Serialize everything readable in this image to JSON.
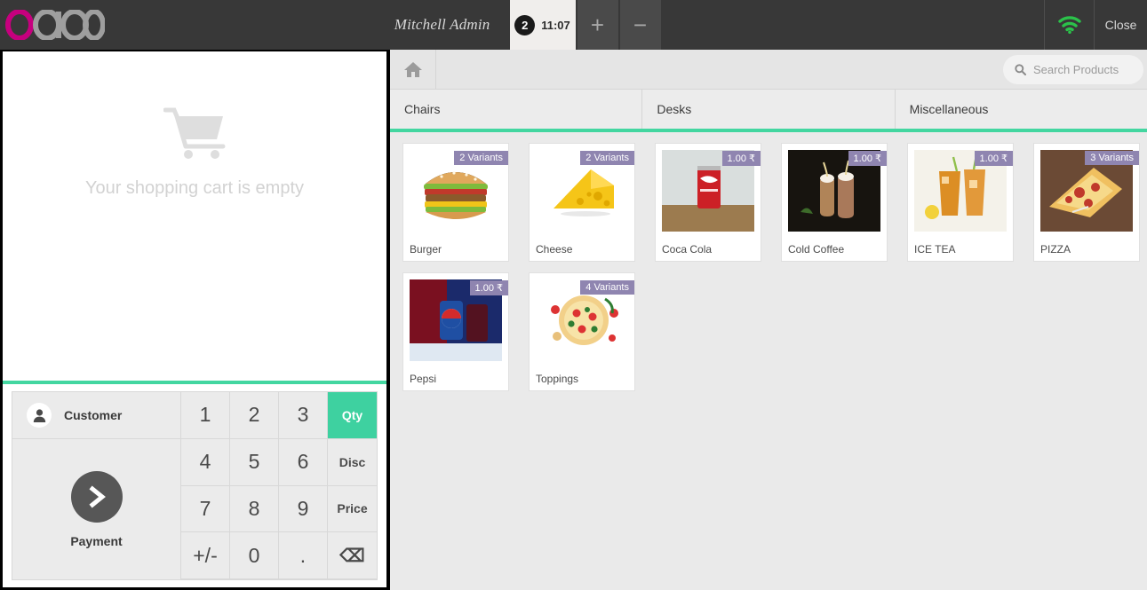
{
  "header": {
    "logo_text": "odoo",
    "user_name": "Mitchell Admin",
    "order_tab": {
      "badge": "2",
      "time": "11:07"
    },
    "add_order_label": "+",
    "remove_order_label": "−",
    "wifi_icon": "wifi-icon",
    "close_label": "Close"
  },
  "cart": {
    "empty_message": "Your shopping cart is empty",
    "cart_icon": "shopping-cart-icon"
  },
  "numpad": {
    "customer_label": "Customer",
    "customer_icon": "user-icon",
    "payment_label": "Payment",
    "payment_icon": "chevron-right-icon",
    "keys": [
      {
        "label": "1",
        "name": "numpad-key-1",
        "type": "digit"
      },
      {
        "label": "2",
        "name": "numpad-key-2",
        "type": "digit"
      },
      {
        "label": "3",
        "name": "numpad-key-3",
        "type": "digit"
      },
      {
        "label": "Qty",
        "name": "numpad-mode-qty",
        "type": "fn",
        "active": true
      },
      {
        "label": "4",
        "name": "numpad-key-4",
        "type": "digit"
      },
      {
        "label": "5",
        "name": "numpad-key-5",
        "type": "digit"
      },
      {
        "label": "6",
        "name": "numpad-key-6",
        "type": "digit"
      },
      {
        "label": "Disc",
        "name": "numpad-mode-disc",
        "type": "fn"
      },
      {
        "label": "7",
        "name": "numpad-key-7",
        "type": "digit"
      },
      {
        "label": "8",
        "name": "numpad-key-8",
        "type": "digit"
      },
      {
        "label": "9",
        "name": "numpad-key-9",
        "type": "digit"
      },
      {
        "label": "Price",
        "name": "numpad-mode-price",
        "type": "fn"
      },
      {
        "label": "+/-",
        "name": "numpad-key-sign",
        "type": "digit"
      },
      {
        "label": "0",
        "name": "numpad-key-0",
        "type": "digit"
      },
      {
        "label": ".",
        "name": "numpad-key-decimal",
        "type": "digit"
      },
      {
        "label": "⌫",
        "name": "numpad-backspace",
        "type": "icon"
      }
    ]
  },
  "products_panel": {
    "home_icon": "home-icon",
    "search": {
      "placeholder": "Search Products",
      "value": "",
      "icon": "search-icon"
    },
    "categories": [
      {
        "label": "Chairs",
        "name": "category-tab-chairs"
      },
      {
        "label": "Desks",
        "name": "category-tab-desks"
      },
      {
        "label": "Miscellaneous",
        "name": "category-tab-miscellaneous"
      }
    ],
    "products": [
      {
        "name": "Burger",
        "badge": "2 Variants",
        "img": "burger"
      },
      {
        "name": "Cheese",
        "badge": "2 Variants",
        "img": "cheese"
      },
      {
        "name": "Coca Cola",
        "badge": "1.00 ₹",
        "img": "cola"
      },
      {
        "name": "Cold Coffee",
        "badge": "1.00 ₹",
        "img": "coldcoffee"
      },
      {
        "name": "ICE TEA",
        "badge": "1.00 ₹",
        "img": "icetea"
      },
      {
        "name": "PIZZA",
        "badge": "3 Variants",
        "img": "pizza"
      },
      {
        "name": "Pepsi",
        "badge": "1.00 ₹",
        "img": "pepsi"
      },
      {
        "name": "Toppings",
        "badge": "4 Variants",
        "img": "toppings"
      }
    ]
  },
  "colors": {
    "header_bg": "#383838",
    "accent_green": "#43d6a0",
    "badge_purple": "#8f85b0",
    "panel_bg": "#eaeaea",
    "payment_circle": "#575757"
  }
}
